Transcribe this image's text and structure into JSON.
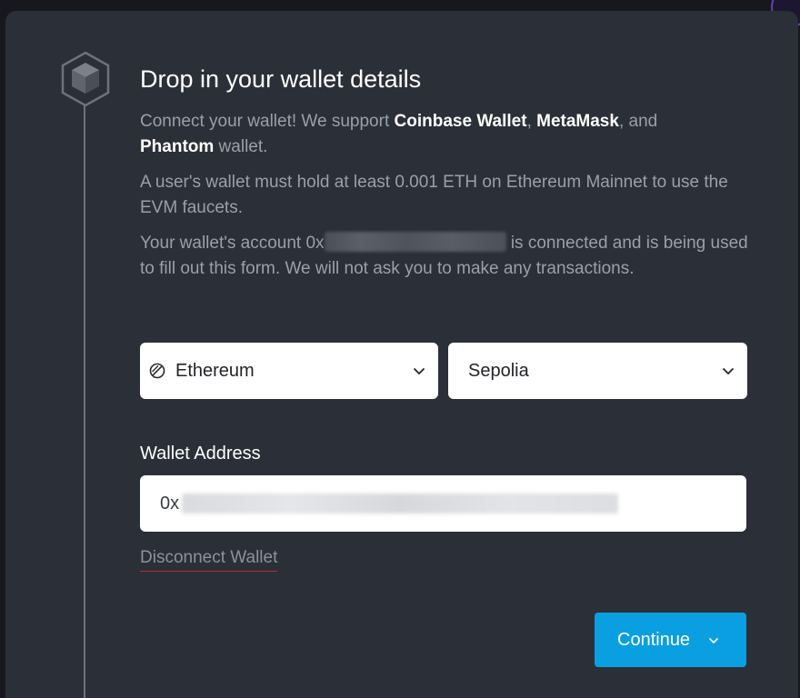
{
  "step": {
    "title": "Drop in your wallet details",
    "icon": "cube-icon"
  },
  "intro": {
    "text_before": "Connect your wallet! We support ",
    "wallet1": "Coinbase Wallet",
    "sep1": ", ",
    "wallet2": "MetaMask",
    "sep2": ", and ",
    "wallet3": "Phantom",
    "text_after": " wallet."
  },
  "requirement": "A user's wallet must hold at least 0.001 ETH on Ethereum Mainnet to use the EVM faucets.",
  "account": {
    "prefix": "Your wallet's account 0x",
    "suffix": " is connected and is being used to fill out this form. We will not ask you to make any transactions."
  },
  "network_select": {
    "value": "Ethereum",
    "icon": "ethereum-icon"
  },
  "testnet_select": {
    "value": "Sepolia"
  },
  "wallet_address": {
    "label": "Wallet Address",
    "prefix": "0x"
  },
  "disconnect_label": "Disconnect Wallet",
  "continue_label": "Continue",
  "colors": {
    "background": "#16181d",
    "card": "#2b2f37",
    "muted_text": "#9aa0a9",
    "accent": "#0a9fe0",
    "underline": "#a8323a"
  }
}
